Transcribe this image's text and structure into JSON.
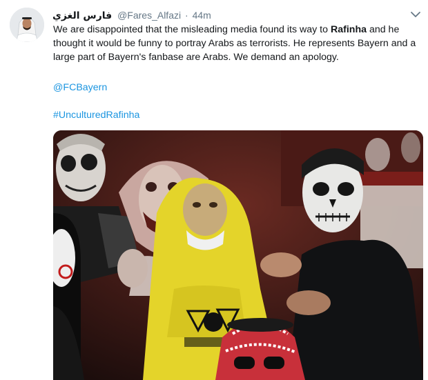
{
  "tweet": {
    "display_name": "فارس الغزي",
    "handle": "@Fares_Alfazi",
    "separator": "·",
    "timestamp": "44m",
    "text_part1": "We are disappointed that the misleading media found its way to ",
    "text_bold": "Rafinha",
    "text_part2": " and he thought it would be funny to portray Arabs as terrorists. He represents Bayern and a large part of Bayern's fanbase are Arabs. We demand an apology.",
    "mention": "@FCBayern",
    "hashtag": "#UnculturedRafinha"
  },
  "icons": {
    "menu": "chevron-down-icon",
    "avatar": "avatar-photo",
    "media": "photo-halloween-costumes"
  },
  "colors": {
    "link": "#1b95e0",
    "secondary_text": "#657786",
    "primary_text": "#14171a",
    "costume_yellow": "#e4d42a"
  }
}
